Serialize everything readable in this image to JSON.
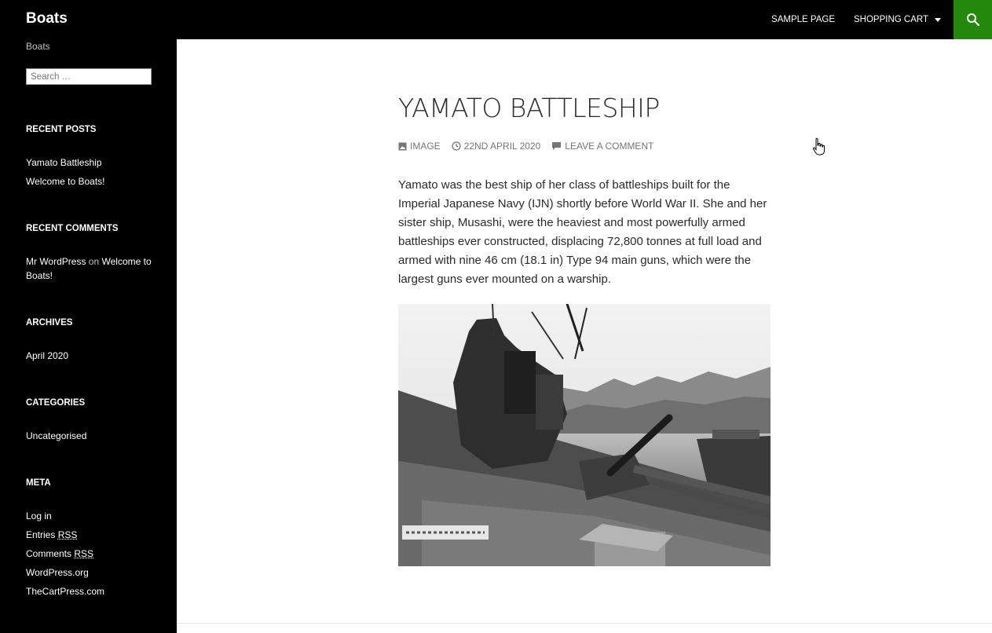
{
  "header": {
    "site_title": "Boats",
    "nav": [
      {
        "label": "SAMPLE PAGE"
      },
      {
        "label": "SHOPPING CART"
      }
    ],
    "search_icon": "search-icon",
    "accent_color": "#24890d"
  },
  "sidebar": {
    "description": "Boats",
    "search_placeholder": "Search …",
    "recent_posts": {
      "title": "RECENT POSTS",
      "items": [
        "Yamato Battleship",
        "Welcome to Boats!"
      ]
    },
    "recent_comments": {
      "title": "RECENT COMMENTS",
      "author": "Mr WordPress",
      "on": "on",
      "post": "Welcome to Boats!"
    },
    "archives": {
      "title": "ARCHIVES",
      "items": [
        "April 2020"
      ]
    },
    "categories": {
      "title": "CATEGORIES",
      "items": [
        "Uncategorised"
      ]
    },
    "meta": {
      "title": "META",
      "log_in": "Log in",
      "entries_prefix": "Entries",
      "comments_prefix": "Comments",
      "rss": "RSS",
      "wordpress_org": "WordPress.org",
      "cartpress": "TheCartPress.com"
    }
  },
  "post": {
    "title": "YAMATO BATTLESHIP",
    "format": "IMAGE",
    "date": "22ND APRIL 2020",
    "comment_link": "LEAVE A COMMENT",
    "body": "Yamato was the best ship of her class of battleships built for the Imperial Japanese Navy (IJN) shortly before World War II. She and her sister ship, Musashi, were the heaviest and most powerfully armed battleships ever constructed, displacing 72,800 tonnes at full load and armed with nine 46 cm (18.1 in) Type 94 main guns, which were the largest guns ever mounted on a warship."
  }
}
